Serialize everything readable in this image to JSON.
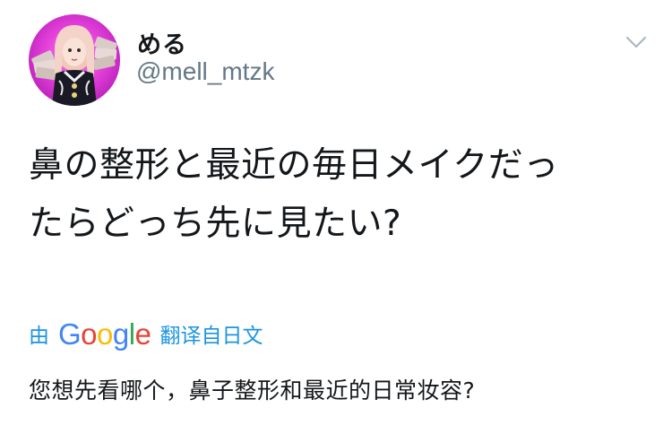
{
  "tweet": {
    "display_name": "める",
    "handle": "@mell_mtzk",
    "text": "鼻の整形と最近の毎日メイクだっ\nたらどっち先に見たい?",
    "caret_icon": "chevron-down-icon"
  },
  "translation": {
    "by_label": "由",
    "provider_logo": "Google",
    "provider_logo_letters": [
      "G",
      "o",
      "o",
      "g",
      "l",
      "e"
    ],
    "provider_logo_colors": [
      "#4285F4",
      "#EA4335",
      "#FBBC05",
      "#4285F4",
      "#34A853",
      "#EA4335"
    ],
    "translated_from_label": "翻译自日文",
    "translated_text": "您想先看哪个，鼻子整形和最近的日常妆容?"
  },
  "colors": {
    "link": "#1b95e0",
    "secondary": "#657786",
    "text": "#14171a",
    "avatar_bg": "#e23fd9"
  }
}
